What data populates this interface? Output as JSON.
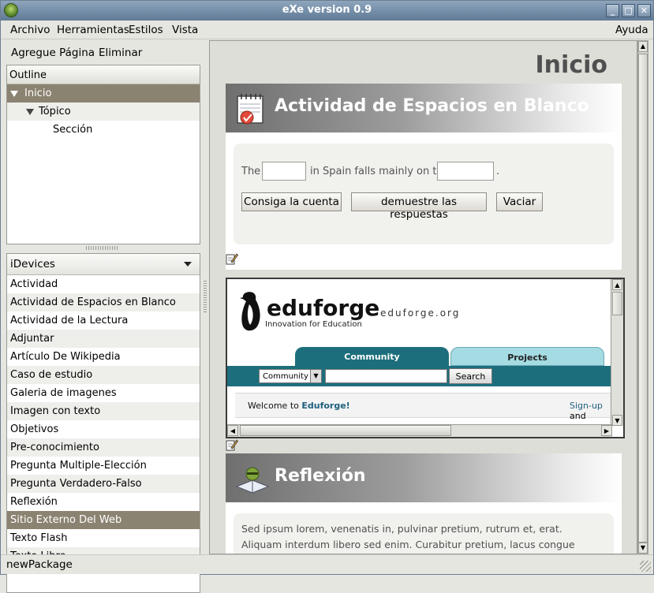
{
  "window": {
    "title": "eXe version 0.9"
  },
  "menu": {
    "items": [
      "Archivo",
      "Herramientas",
      "Estilos",
      "Vista"
    ],
    "help": "Ayuda"
  },
  "toolbar": {
    "add_page": "Agregue Página",
    "delete": "Eliminar"
  },
  "outline": {
    "header": "Outline",
    "nodes": [
      {
        "label": "Inicio",
        "selected": true
      },
      {
        "label": "Tópico",
        "selected": false
      },
      {
        "label": "Sección",
        "selected": false
      }
    ]
  },
  "idevices": {
    "selector": "iDevices",
    "items": [
      "Actividad",
      "Actividad de Espacios en Blanco",
      "Actividad de la Lectura",
      "Adjuntar",
      "Artículo De Wikipedia",
      "Caso de estudio",
      "Galeria de imagenes",
      "Imagen con texto",
      "Objetivos",
      "Pre-conocimiento",
      "Pregunta Multiple-Elección",
      "Pregunta Verdadero-Falso",
      "Reflexión",
      "Sitio Externo Del Web",
      "Texto Flash",
      "Texto Libre"
    ],
    "selected": "Sitio Externo Del Web"
  },
  "page": {
    "title": "Inicio"
  },
  "cloze": {
    "heading": "Actividad de Espacios en Blanco",
    "text_before": "The",
    "text_middle": "in Spain falls mainly on the",
    "text_after": ".",
    "blank1": "",
    "blank2": "",
    "buttons": {
      "score": "Consiga la cuenta",
      "show": "demuestre las respuestas",
      "clear": "Vaciar"
    }
  },
  "website": {
    "logo": "eduforge",
    "tagline": "Innovation for Education",
    "domain": "eduforge.org",
    "tabs": {
      "community": "Community",
      "projects": "Projects"
    },
    "select_value": "Community",
    "search_button": "Search",
    "welcome_prefix": "Welcome to ",
    "welcome_link": "Eduforge!",
    "signup": "Sign-up",
    "signup_tail": " and"
  },
  "reflection": {
    "heading": "Reflexión",
    "body": "Sed ipsum lorem, venenatis in, pulvinar pretium, rutrum et, erat. Aliquam interdum libero sed enim. Curabitur pretium, lacus congue sagittis iaculis, lorem"
  },
  "status": {
    "text": "newPackage"
  },
  "colors": {
    "selected": "#8b8371",
    "teal": "#1d6e7c",
    "tab_light": "#a5dbe2",
    "logo_teal": "#2a7f8d"
  }
}
